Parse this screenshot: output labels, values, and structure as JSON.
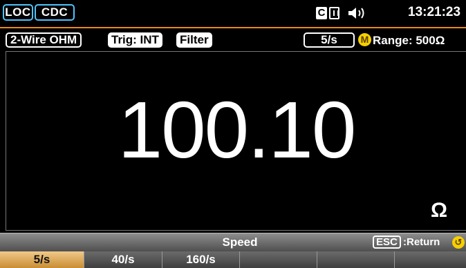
{
  "status": {
    "loc_label": "LOC",
    "cdc_label": "CDC",
    "c_icon_label": "C",
    "time": "13:21:23"
  },
  "info": {
    "mode": "2-Wire OHM",
    "trigger": "Trig: INT",
    "filter": "Filter",
    "rate": "5/s",
    "m_icon_label": "M",
    "range": "Range:  500Ω"
  },
  "display": {
    "reading": "100.10",
    "unit": "Ω"
  },
  "softbar": {
    "title": "Speed",
    "esc_key": "ESC",
    "esc_label": ":Return"
  },
  "softkeys": [
    {
      "label": "5/s",
      "active": true
    },
    {
      "label": "40/s",
      "active": false
    },
    {
      "label": "160/s",
      "active": false
    },
    {
      "label": "",
      "active": false
    },
    {
      "label": "",
      "active": false
    },
    {
      "label": "",
      "active": false
    }
  ],
  "colors": {
    "accent_orange": "#e88a1d",
    "status_cyan": "#4fc4ff",
    "indicator_yellow": "#f5d000",
    "active_softkey": "#e0ad5c"
  },
  "icons": {
    "c_icon": "c-icon",
    "memory_icon": "memory-icon",
    "speaker_icon": "speaker-icon",
    "m_icon": "m-icon",
    "return_icon": "return-icon"
  }
}
